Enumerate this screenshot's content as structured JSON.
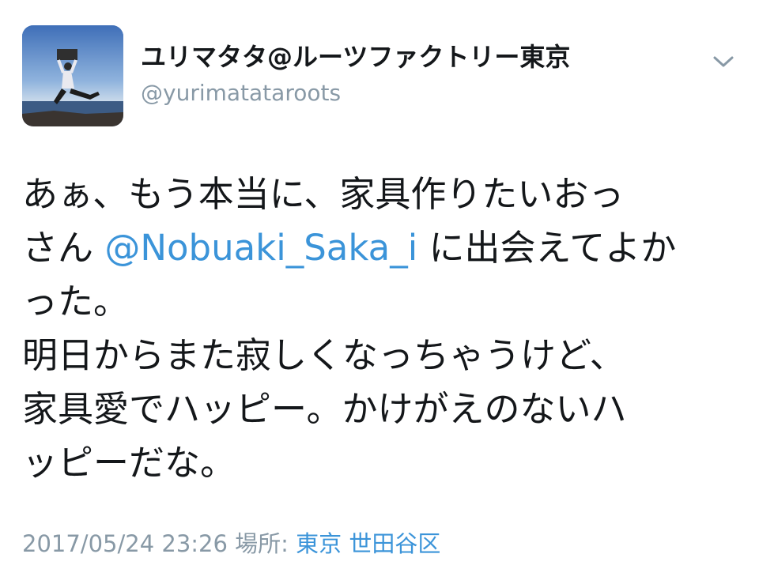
{
  "user": {
    "display_name": "ユリマタタ@ルーツファクトリー東京",
    "handle": "@yurimatataroots",
    "avatar_icon": "profile-photo-jumping-by-sea"
  },
  "menu_icon": "chevron-down-icon",
  "tweet": {
    "line1": "あぁ、もう本当に、家具作りたいおっ",
    "line2_prefix": "さん ",
    "mention": "@Nobuaki_Saka_i",
    "line2_suffix": " に出会えてよか",
    "line3": "った。",
    "line4": "明日からまた寂しくなっちゃうけど、",
    "line5": "家具愛でハッピー。かけがえのないハ",
    "line6": "ッピーだな。"
  },
  "meta": {
    "timestamp": "2017/05/24 23:26",
    "location_label": "場所:",
    "location_city": "東京",
    "location_ward": "世田谷区"
  },
  "colors": {
    "link": "#3b94d9",
    "muted": "#8899a6",
    "text": "#14171a"
  }
}
